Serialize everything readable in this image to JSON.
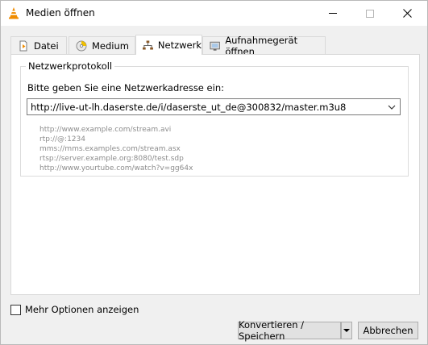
{
  "window": {
    "title": "Medien öffnen",
    "icon": "vlc-cone-icon"
  },
  "tabs": [
    {
      "label": "Datei",
      "icon": "file-icon",
      "active": false
    },
    {
      "label": "Medium",
      "icon": "disc-icon",
      "active": false
    },
    {
      "label": "Netzwerk",
      "icon": "network-icon",
      "active": true
    },
    {
      "label": "Aufnahmegerät öffnen",
      "icon": "capture-device-icon",
      "active": false
    }
  ],
  "network": {
    "group_title": "Netzwerkprotokoll",
    "prompt": "Bitte geben Sie eine Netzwerkadresse ein:",
    "url_value": "http://live-ut-lh.daserste.de/i/daserste_ut_de@300832/master.m3u8",
    "examples": [
      "http://www.example.com/stream.avi",
      "rtp://@:1234",
      "mms://mms.examples.com/stream.asx",
      "rtsp://server.example.org:8080/test.sdp",
      "http://www.yourtube.com/watch?v=gg64x"
    ]
  },
  "footer": {
    "more_options_label": "Mehr Optionen anzeigen",
    "more_options_checked": false,
    "convert_label": "Konvertieren / Speichern",
    "cancel_label": "Abbrechen"
  },
  "colors": {
    "vlc_orange": "#f08c00",
    "example_text": "#8c8c8c"
  }
}
